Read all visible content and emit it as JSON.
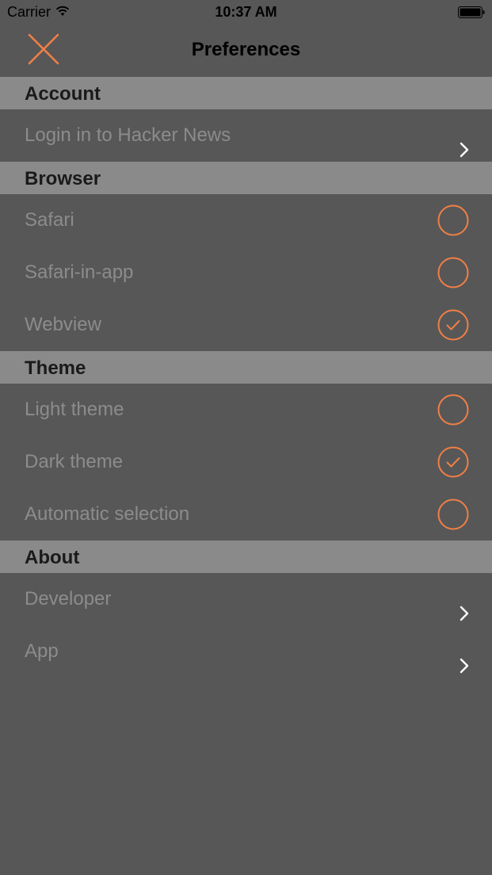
{
  "status_bar": {
    "carrier": "Carrier",
    "time": "10:37 AM"
  },
  "nav": {
    "title": "Preferences",
    "close_icon": "close-icon"
  },
  "colors": {
    "accent": "#f07f46",
    "background": "#575757",
    "section_header": "#8a8a8a",
    "row_text": "#8c8c8c"
  },
  "sections": [
    {
      "title": "Account",
      "rows": [
        {
          "label": "Login in to Hacker News",
          "accessory": "chevron-right-icon"
        }
      ]
    },
    {
      "title": "Browser",
      "rows": [
        {
          "label": "Safari",
          "accessory": "radio",
          "selected": false
        },
        {
          "label": "Safari-in-app",
          "accessory": "radio",
          "selected": false
        },
        {
          "label": "Webview",
          "accessory": "radio",
          "selected": true
        }
      ]
    },
    {
      "title": "Theme",
      "rows": [
        {
          "label": "Light theme",
          "accessory": "radio",
          "selected": false
        },
        {
          "label": "Dark theme",
          "accessory": "radio",
          "selected": true
        },
        {
          "label": "Automatic selection",
          "accessory": "radio",
          "selected": false
        }
      ]
    },
    {
      "title": "About",
      "rows": [
        {
          "label": "Developer",
          "accessory": "chevron-right-icon"
        },
        {
          "label": "App",
          "accessory": "chevron-right-icon"
        }
      ]
    }
  ]
}
